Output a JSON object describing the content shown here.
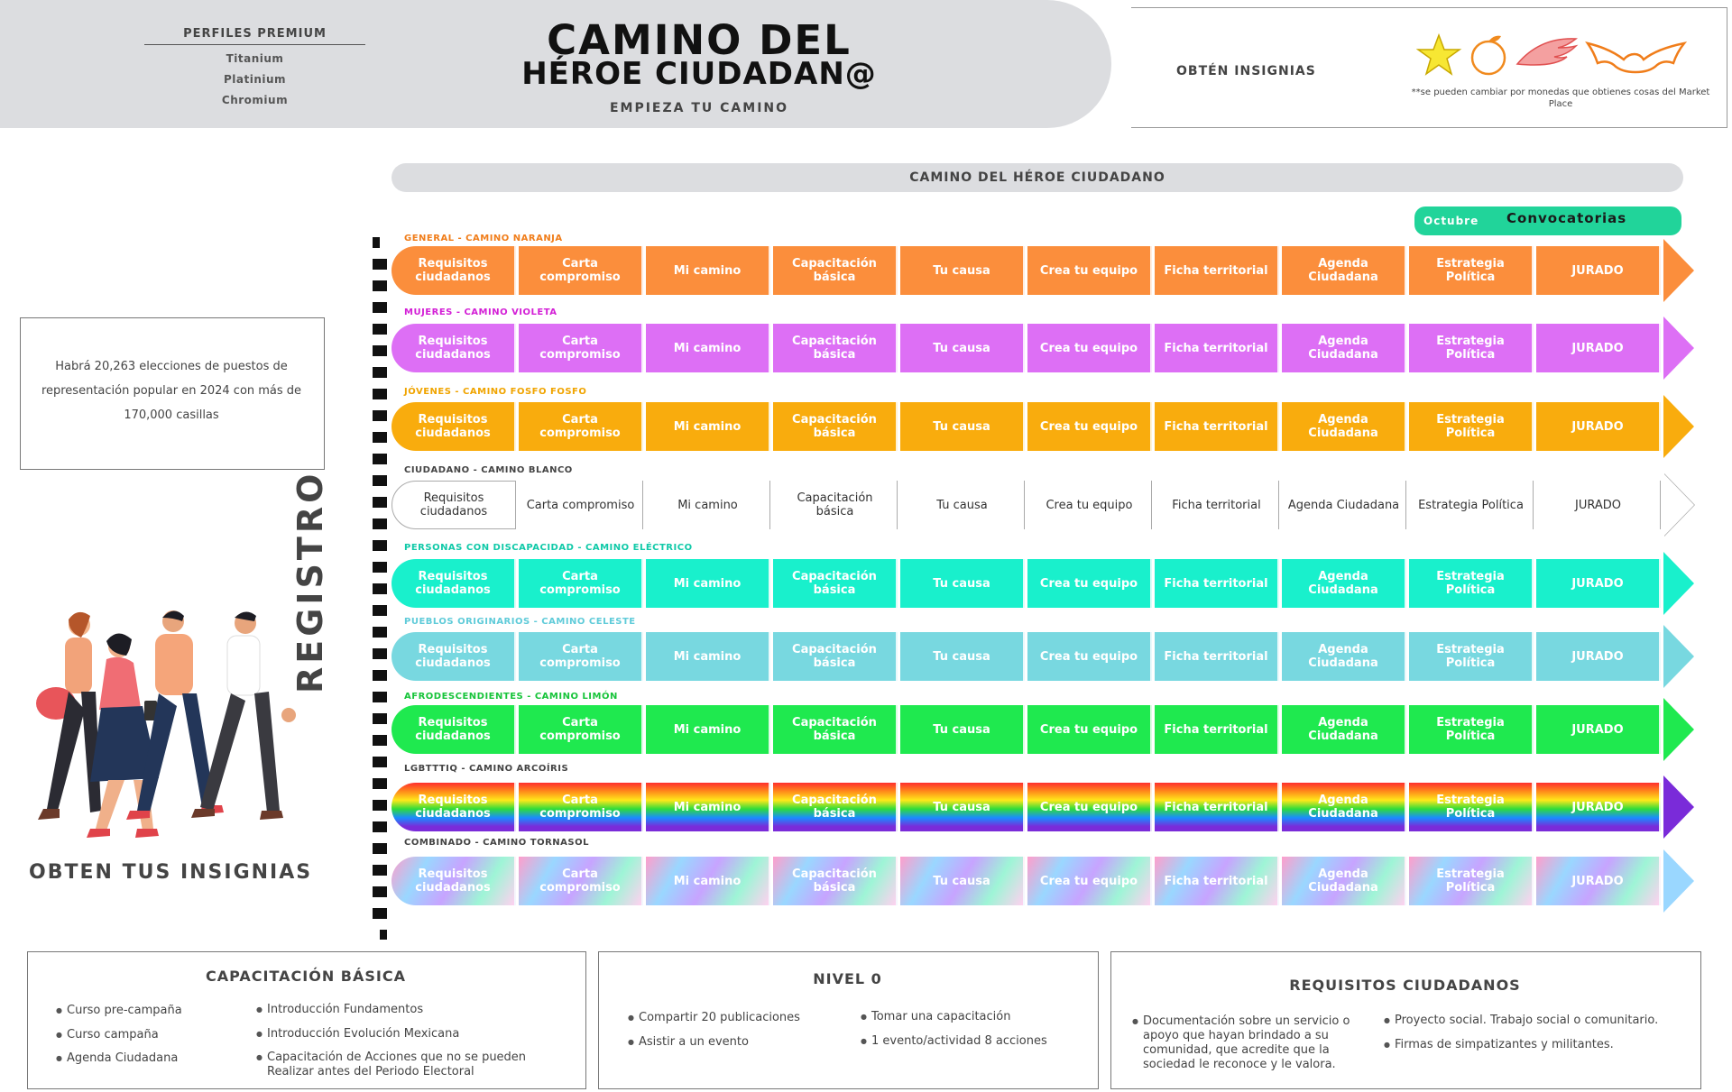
{
  "header": {
    "premium_title": "PERFILES PREMIUM",
    "premium_items": [
      "Titanium",
      "Platinium",
      "Chromium"
    ],
    "title_line1": "CAMINO DEL",
    "title_line2": "HÉROE CIUDADAN@",
    "subtitle": "EMPIEZA TU CAMINO",
    "badges_title": "OBTÉN INSIGNIAS",
    "badges_note": "**se pueden cambiar por monedas que obtienes cosas del Market Place",
    "badge_icons": [
      "star-icon",
      "orange-icon",
      "wing-icon",
      "bat-icon"
    ]
  },
  "path": {
    "bar_label": "CAMINO DEL HÉROE CIUDADANO",
    "month": "Octubre",
    "convocatorias": "Convocatorias"
  },
  "left": {
    "elections_text": "Habrá 20,263 elecciones de puestos de representación popular en 2024 con más de 170,000 casillas",
    "registro": "REGISTRO",
    "insignias": "OBTEN TUS INSIGNIAS"
  },
  "steps": [
    "Requisitos ciudadanos",
    "Carta compromiso",
    "Mi camino",
    "Capacitación básica",
    "Tu causa",
    "Crea tu equipo",
    "Ficha territorial",
    "Agenda Ciudadana",
    "Estrategia Política",
    "JURADO"
  ],
  "lanes": [
    {
      "label": "GENERAL - CAMINO NARANJA",
      "label_color": "#f07d1a",
      "style": "orange"
    },
    {
      "label": "MUJERES - CAMINO VIOLETA",
      "label_color": "#d31fd6",
      "style": "violet"
    },
    {
      "label": "JÓVENES - CAMINO FOSFO FOSFO",
      "label_color": "#f0a400",
      "style": "yellow"
    },
    {
      "label": "CIUDADANO - CAMINO BLANCO",
      "label_color": "#444444",
      "style": "white"
    },
    {
      "label": "PERSONAS CON DISCAPACIDAD - CAMINO ELÉCTRICO",
      "label_color": "#10c9a8",
      "style": "electric"
    },
    {
      "label": "PUEBLOS ORIGINARIOS - CAMINO CELESTE",
      "label_color": "#5fcbd9",
      "style": "celeste"
    },
    {
      "label": "AFRODESCENDIENTES - CAMINO LIMÓN",
      "label_color": "#17c43a",
      "style": "lemon"
    },
    {
      "label": "LGBTTTIQ - CAMINO ARCOÍRIS",
      "label_color": "#444444",
      "style": "rainbow"
    },
    {
      "label": "COMBINADO - CAMINO TORNASOL",
      "label_color": "#444444",
      "style": "tornasol"
    }
  ],
  "colors": {
    "orange": "#fb8e3c",
    "violet": "#dd6ff5",
    "yellow": "#f9ac0d",
    "electric": "#19f0cc",
    "celeste": "#78d8e0",
    "lemon": "#1fe94f"
  },
  "boxes": {
    "capacitacion": {
      "title": "CAPACITACIÓN BÁSICA",
      "left": [
        "Curso pre-campaña",
        "Curso campaña",
        "Agenda Ciudadana"
      ],
      "right": [
        "Introducción Fundamentos",
        "Introducción Evolución Mexicana",
        "Capacitación de Acciones que no se pueden Realizar antes del Periodo Electoral"
      ]
    },
    "nivel": {
      "title": "NIVEL 0",
      "left": [
        "Compartir 20 publicaciones",
        "Asistir a un evento"
      ],
      "right": [
        "Tomar una capacitación",
        "1 evento/actividad 8 acciones"
      ]
    },
    "requisitos": {
      "title": "REQUISITOS CIUDADANOS",
      "left": [
        "Documentación sobre un servicio o apoyo que hayan brindado a su comunidad, que acredite que la sociedad le reconoce y le valora."
      ],
      "right": [
        "Proyecto social. Trabajo social o comunitario.",
        "Firmas de simpatizantes y militantes."
      ]
    }
  }
}
